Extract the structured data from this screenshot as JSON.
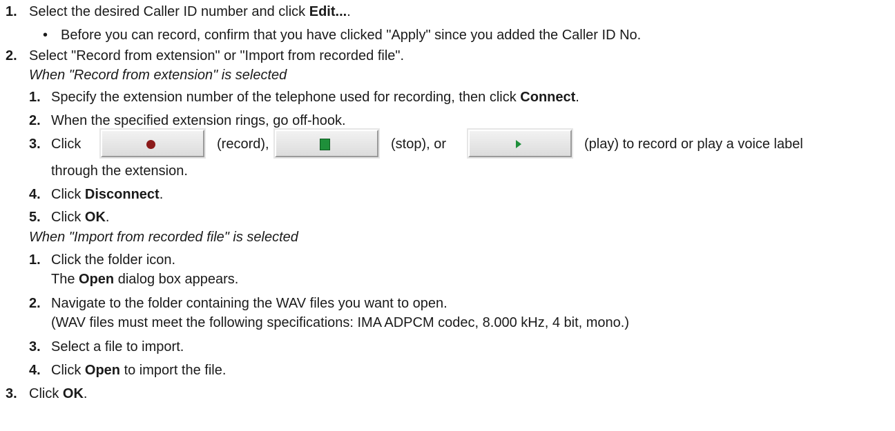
{
  "steps": {
    "s1": {
      "num": "1.",
      "pre": "Select the desired Caller ID number and click ",
      "bold": "Edit...",
      "post": ".",
      "bullet_mark": "•",
      "bullet_text": "Before you can record, confirm that you have clicked \"Apply\" since you added the Caller ID No."
    },
    "s2": {
      "num": "2.",
      "text": "Select \"Record from extension\" or \"Import from recorded file\".",
      "section_a_title": "When \"Record from extension\" is selected",
      "a1": {
        "num": "1.",
        "pre": "Specify the extension number of the telephone used for recording, then click ",
        "bold": "Connect",
        "post": "."
      },
      "a2": {
        "num": "2.",
        "text": "When the specified extension rings, go off-hook."
      },
      "a3": {
        "num": "3.",
        "click": "Click",
        "record_label": "(record),",
        "stop_label": "(stop), or",
        "play_label": "(play) to record or play a voice label",
        "cont": "through the extension."
      },
      "a4": {
        "num": "4.",
        "pre": "Click ",
        "bold": "Disconnect",
        "post": "."
      },
      "a5": {
        "num": "5.",
        "pre": "Click ",
        "bold": "OK",
        "post": "."
      },
      "section_b_title": "When \"Import from recorded file\" is selected",
      "b1": {
        "num": "1.",
        "text": "Click the folder icon.",
        "line2_pre": "The ",
        "line2_bold": "Open",
        "line2_post": " dialog box appears."
      },
      "b2": {
        "num": "2.",
        "text": "Navigate to the folder containing the WAV files you want to open.",
        "line2": "(WAV files must meet the following specifications: IMA ADPCM codec, 8.000 kHz, 4 bit, mono.)"
      },
      "b3": {
        "num": "3.",
        "text": "Select a file to import."
      },
      "b4": {
        "num": "4.",
        "pre": "Click ",
        "bold": "Open",
        "post": " to import the file."
      }
    },
    "s3": {
      "num": "3.",
      "pre": "Click ",
      "bold": "OK",
      "post": "."
    }
  },
  "icons": {
    "record": "record-icon",
    "stop": "stop-icon",
    "play": "play-icon"
  },
  "colors": {
    "record_dot": "#8b1a1a",
    "stop_play_green": "#1e8f3a"
  }
}
